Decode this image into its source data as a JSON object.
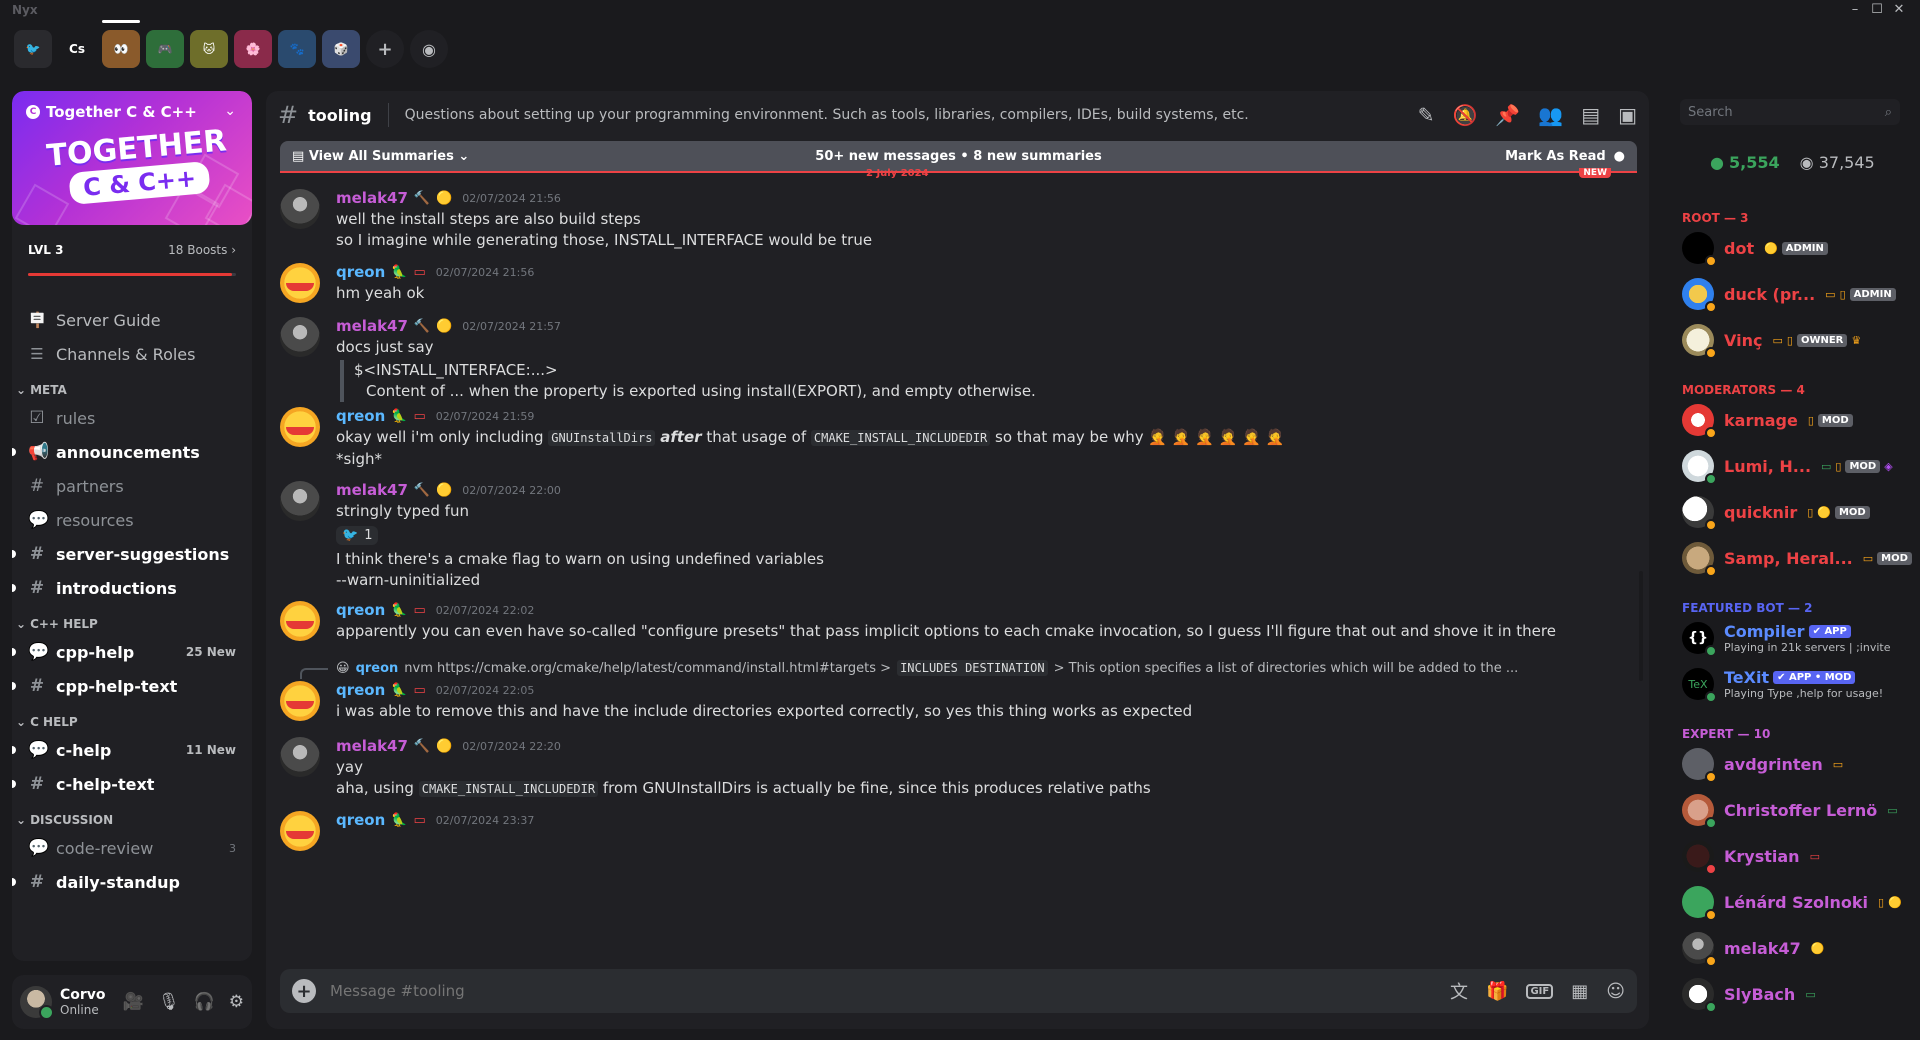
{
  "window": {
    "app_name": "Nyx",
    "controls": [
      "–",
      "☐",
      "✕"
    ]
  },
  "servers": [
    {
      "label": "🐦",
      "bg": "#2a2a2e"
    },
    {
      "label": "Cs",
      "bg": "#1a1a1d"
    },
    {
      "label": "👀",
      "bg": "#8a5a2b",
      "active": true
    },
    {
      "label": "🎮",
      "bg": "#2e6e3a"
    },
    {
      "label": "🐱",
      "bg": "#6e6e2a"
    },
    {
      "label": "🌸",
      "bg": "#8a2a4a"
    },
    {
      "label": "🐾",
      "bg": "#2a4a6e"
    },
    {
      "label": "🎲",
      "bg": "#3a4a6e"
    },
    {
      "label": "+",
      "bg": "#202024"
    },
    {
      "label": "◉",
      "bg": "#202024"
    }
  ],
  "guild": {
    "name": "Together C & C++",
    "art_line1": "TOGETHER",
    "art_line2": "C & C++",
    "level": "LVL 3",
    "boosts": "18 Boosts",
    "boost_progress": 0.98
  },
  "nav": [
    {
      "label": "Server Guide",
      "icon": "🪧"
    },
    {
      "label": "Channels & Roles",
      "icon": "☰"
    }
  ],
  "categories": {
    "meta": "META",
    "cpp_help": "C++ HELP",
    "c_help": "C HELP",
    "discussion": "DISCUSSION"
  },
  "channels": {
    "meta": [
      {
        "label": "rules",
        "icon": "☑",
        "unread": false
      },
      {
        "label": "announcements",
        "icon": "📢",
        "unread": true
      },
      {
        "label": "partners",
        "icon": "#",
        "unread": false
      },
      {
        "label": "resources",
        "icon": "💬",
        "unread": false
      },
      {
        "label": "server-suggestions",
        "icon": "#",
        "unread": true
      },
      {
        "label": "introductions",
        "icon": "#",
        "unread": true
      }
    ],
    "cpp_help": [
      {
        "label": "cpp-help",
        "icon": "💬",
        "unread": true,
        "badge": "25 New"
      },
      {
        "label": "cpp-help-text",
        "icon": "#",
        "unread": true
      }
    ],
    "c_help": [
      {
        "label": "c-help",
        "icon": "💬",
        "unread": true,
        "badge": "11 New"
      },
      {
        "label": "c-help-text",
        "icon": "#",
        "unread": true
      }
    ],
    "discussion": [
      {
        "label": "code-review",
        "icon": "💬",
        "unread": false,
        "count": "3"
      },
      {
        "label": "daily-standup",
        "icon": "#",
        "unread": true
      }
    ]
  },
  "user": {
    "name": "Corvo",
    "status": "Online"
  },
  "channel": {
    "name": "tooling",
    "topic": "Questions about setting up your programming environment. Such as tools, libraries, compilers, IDEs, build systems, etc."
  },
  "summary": {
    "view_all": "View All Summaries",
    "stats": "50+ new messages  •  8 new summaries",
    "mark_read": "Mark As Read",
    "new_pill": "NEW",
    "date_divider": "2 July 2024"
  },
  "messages": [
    {
      "author": "melak47",
      "who": "m",
      "time": "02/07/2024 21:56",
      "lines": [
        "well the install steps are also build steps",
        "so I imagine while generating those, INSTALL_INTERFACE would be true"
      ]
    },
    {
      "author": "qreon",
      "who": "q",
      "time": "02/07/2024 21:56",
      "lines": [
        "hm yeah ok"
      ]
    },
    {
      "author": "melak47",
      "who": "m",
      "time": "02/07/2024 21:57",
      "lines": [
        "docs just say"
      ],
      "quote": [
        "$<INSTALL_INTERFACE:...>",
        "Content of ... when the property is exported using install(EXPORT), and empty otherwise."
      ]
    },
    {
      "author": "qreon",
      "who": "q",
      "time": "02/07/2024 21:59",
      "l1a": "okay well i'm only including ",
      "l1code1": "GNUInstallDirs",
      "l1em": "after",
      "l1b": " that usage of ",
      "l1code2": "CMAKE_INSTALL_INCLUDEDIR",
      "l1c": " so that may be why 🤦 🤦 🤦 🤦 🤦 🤦",
      "l2": "*sigh*"
    },
    {
      "author": "melak47",
      "who": "m",
      "time": "02/07/2024 22:00",
      "lines": [
        "stringly typed fun"
      ],
      "reaction": {
        "emoji": "🐦",
        "count": "1"
      },
      "after": [
        "I think there's a cmake flag to warn on using undefined variables",
        "--warn-uninitialized"
      ]
    },
    {
      "author": "qreon",
      "who": "q",
      "time": "02/07/2024 22:02",
      "lines": [
        "apparently you can even have so-called \"configure presets\" that pass implicit options to each cmake invocation, so I guess I'll figure that out and shove it in there"
      ]
    },
    {
      "reply_author": "qreon",
      "reply_a": "nvm https://cmake.org/cmake/help/latest/command/install.html#targets > ",
      "reply_code": "INCLUDES DESTINATION",
      "reply_b": " > This option specifies a list of directories which will be added to the ...",
      "author": "qreon",
      "who": "q",
      "time": "02/07/2024 22:05",
      "lines": [
        "i was able to remove this and have the include directories exported correctly, so yes this thing works as expected"
      ]
    },
    {
      "author": "melak47",
      "who": "m",
      "time": "02/07/2024 22:20",
      "lines": [
        "yay"
      ],
      "l2a": "aha, using ",
      "l2code": "CMAKE_INSTALL_INCLUDEDIR",
      "l2b": " from GNUInstallDirs is actually be fine, since this produces relative paths"
    },
    {
      "author": "qreon",
      "who": "q",
      "time": "02/07/2024 23:37",
      "lines": []
    }
  ],
  "composer": {
    "placeholder": "Message #tooling",
    "gif": "GIF"
  },
  "members": {
    "search_placeholder": "Search",
    "online_count": "5,554",
    "total_count": "37,545",
    "groups": {
      "root": "ROOT — 3",
      "mods": "MODERATORS — 4",
      "bots": "FEATURED BOT — 2",
      "expert": "EXPERT — 10"
    },
    "root": [
      {
        "name": "dot",
        "tag": "ADMIN"
      },
      {
        "name": "duck (pr...",
        "tag": "ADMIN"
      },
      {
        "name": "Vinç",
        "tag": "OWNER"
      }
    ],
    "mods": [
      {
        "name": "karnage",
        "tag": "MOD"
      },
      {
        "name": "Lumi, H...",
        "tag": "MOD"
      },
      {
        "name": "quicknir",
        "tag": "MOD"
      },
      {
        "name": "Samp, Heral...",
        "tag": "MOD"
      }
    ],
    "bots": [
      {
        "name": "Compiler",
        "tag": "✔ APP",
        "activity": "Playing in 21k servers | ;invite"
      },
      {
        "name": "TeXit",
        "tag": "✔ APP • MOD",
        "activity": "Playing Type ,help for usage!"
      }
    ],
    "expert": [
      {
        "name": "avdgrinten"
      },
      {
        "name": "Christoffer Lernö"
      },
      {
        "name": "Krystian"
      },
      {
        "name": "Lénárd Szolnoki"
      },
      {
        "name": "melak47"
      },
      {
        "name": "SlyBach"
      }
    ]
  },
  "colors": {
    "accent": "#ed4245",
    "online": "#3ba55d",
    "melak": "#c65dd6",
    "qreon": "#5bb8ff",
    "root": "#ed4245",
    "mods": "#ed4245",
    "bots": "#5865f2",
    "expert": "#c65dd6"
  }
}
